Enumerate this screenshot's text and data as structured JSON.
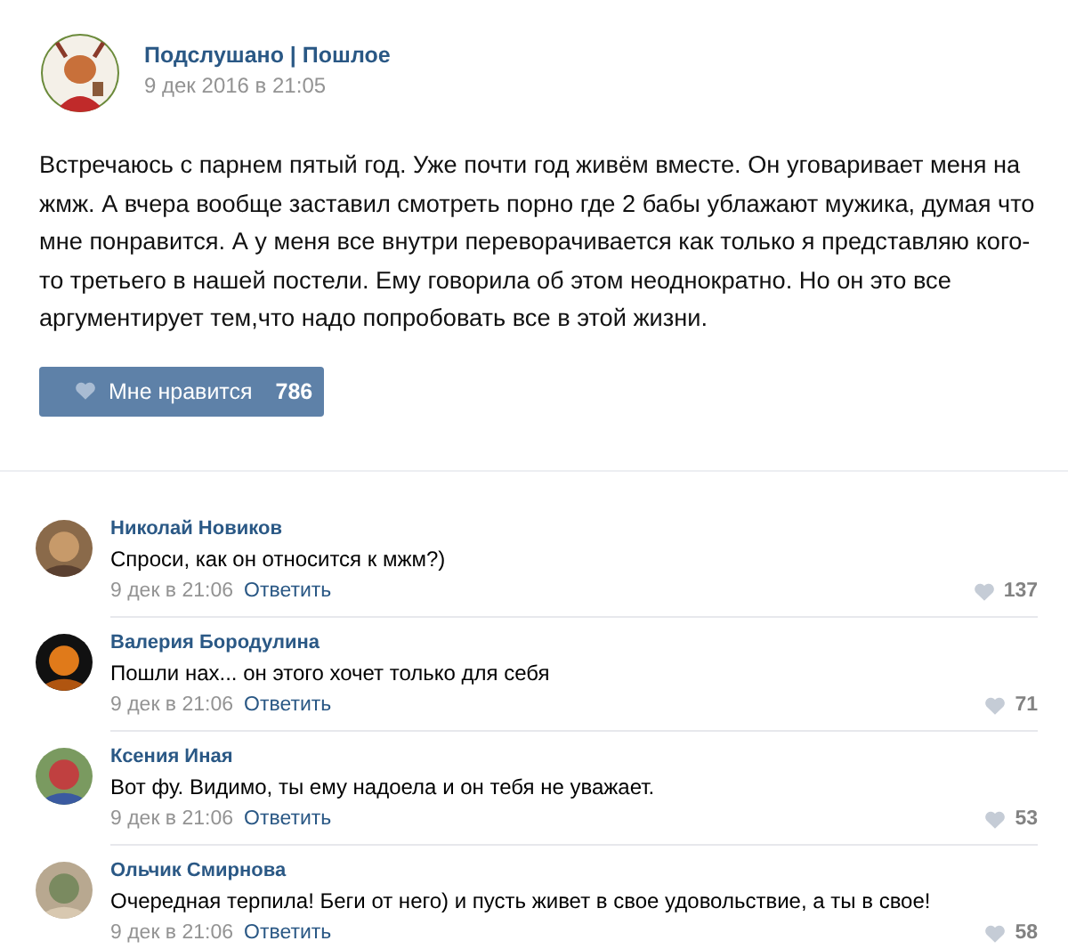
{
  "post": {
    "author": "Подслушано | Пошлое",
    "date": "9 дек 2016 в 21:05",
    "text": "Встречаюсь с парнем пятый год. Уже почти год живём вместе. Он уговаривает меня на жмж. А вчера вообще заставил смотреть порно где 2 бабы ублажают мужика, думая что мне понравится. А у меня все внутри переворачивается как только я представляю кого-то третьего в нашей постели. Ему говорила об этом неоднократно. Но он это все аргументирует тем,что надо попробовать все в этой жизни.",
    "like_label": "Мне нравится",
    "like_count": "786"
  },
  "comments": [
    {
      "author": "Николай Новиков",
      "text": "Спроси, как он относится к мжм?)",
      "date": "9 дек в 21:06",
      "reply": "Ответить",
      "likes": "137"
    },
    {
      "author": "Валерия Бородулина",
      "text": "Пошли нах... он этого хочет только для себя",
      "date": "9 дек в 21:06",
      "reply": "Ответить",
      "likes": "71"
    },
    {
      "author": "Ксения Иная",
      "text": "Вот фу. Видимо, ты ему надоела и он тебя не уважает.",
      "date": "9 дек в 21:06",
      "reply": "Ответить",
      "likes": "53"
    },
    {
      "author": "Ольчик Смирнова",
      "text": "Очередная терпила! Беги от него) и пусть живет в свое удовольствие, а ты в свое!",
      "date": "9 дек в 21:06",
      "reply": "Ответить",
      "likes": "58"
    }
  ]
}
